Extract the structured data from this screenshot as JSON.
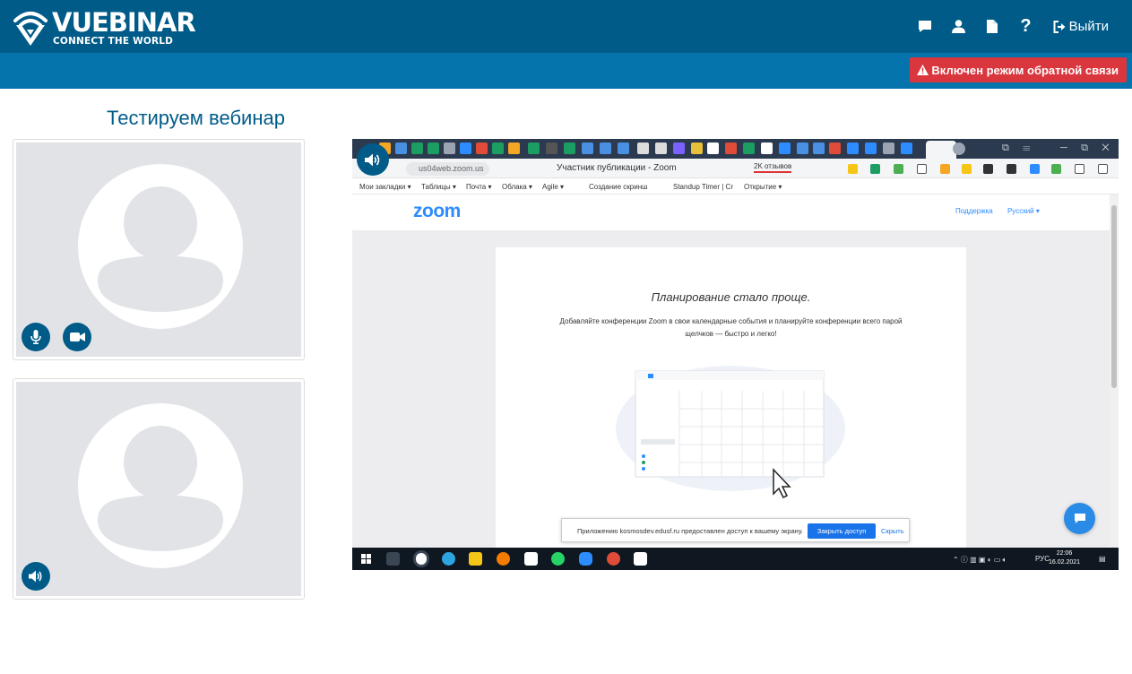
{
  "brand": {
    "name": "VUEBINAR",
    "tagline": "CONNECT THE WORLD"
  },
  "header": {
    "nav": [
      {
        "icon": "chat-icon"
      },
      {
        "icon": "user-icon"
      },
      {
        "icon": "document-icon"
      },
      {
        "icon": "help-icon",
        "label": "?"
      }
    ],
    "logout_label": "Выйти"
  },
  "subbar": {
    "feedback_badge": "Включен режим обратной связи",
    "badge_color": "#d9363e"
  },
  "page": {
    "title": "Тестируем вебинар"
  },
  "participants": [
    {
      "controls": [
        "microphone-icon",
        "camera-icon"
      ]
    },
    {
      "controls": [
        "speaker-icon"
      ]
    }
  ],
  "screen_share": {
    "browser": {
      "url": "us04web.zoom.us",
      "tab_title": "Участник публикации - Zoom",
      "reviews_badge": "2K отзывов",
      "bookmarks": [
        "Мои закладки ▾",
        "Таблицы ▾",
        "Почта ▾",
        "Облака ▾",
        "Agile ▾",
        "Создание скринш",
        "Standup Timer | Cr",
        "Открытие ▾"
      ]
    },
    "zoom_page": {
      "logo": "zoom",
      "links": [
        "Поддержка",
        "Русский ▾"
      ],
      "heading": "Планирование стало проще.",
      "text": "Добавляйте конференции Zoom в свои календарные события и планируйте конференции всего парой щелчков — быстро и легко!"
    },
    "notice": {
      "text": "Приложению kosmosdev.edusf.ru предоставлен доступ к вашему экрану.",
      "stop_button": "Закрыть доступ",
      "hide_link": "Скрыть"
    },
    "taskbar": {
      "lang": "РУС",
      "time": "22:06",
      "date": "16.02.2021"
    }
  },
  "colors": {
    "header": "#005b89",
    "subbar": "#0574ad",
    "accent": "#005b89",
    "chat_fab": "#2a8be6"
  }
}
